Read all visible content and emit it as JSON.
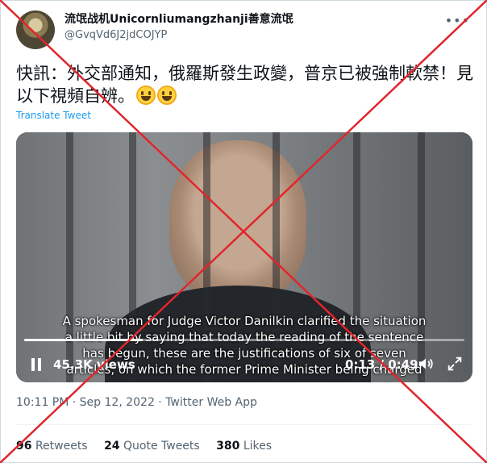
{
  "author": {
    "name": "流氓战机Unicornliumangzhanji善意流氓",
    "handle": "@GvqVd6J2jdCOJYP"
  },
  "tweet": {
    "text": "快訊：外交部通知，俄羅斯發生政變，普京已被強制軟禁！見以下視頻自辨。",
    "translate_label": "Translate Tweet"
  },
  "video": {
    "subtitle_lines": [
      "A spokesman for Judge Victor Danilkin clarified the situation",
      "a little bit by saying that today the reading of the sentence",
      "has begun, these are the justifications of six of seven",
      "articles, on which the former Prime Minister being charged"
    ],
    "views": "45.3K views",
    "time": "0:13 / 0:49",
    "progress_fraction": 0.27
  },
  "meta": {
    "timestamp": "10:11 PM · Sep 12, 2022 · Twitter Web App"
  },
  "stats": {
    "retweets_count": "96",
    "retweets_label": "Retweets",
    "quotes_count": "24",
    "quotes_label": "Quote Tweets",
    "likes_count": "380",
    "likes_label": "Likes"
  },
  "icons": {
    "more": "more-icon",
    "pause": "pause-icon",
    "volume": "volume-icon",
    "fullscreen": "fullscreen-icon",
    "emoji": "grinning-face-emoji"
  },
  "colors": {
    "link": "#1d9bf0",
    "cross": "#e0262d"
  }
}
